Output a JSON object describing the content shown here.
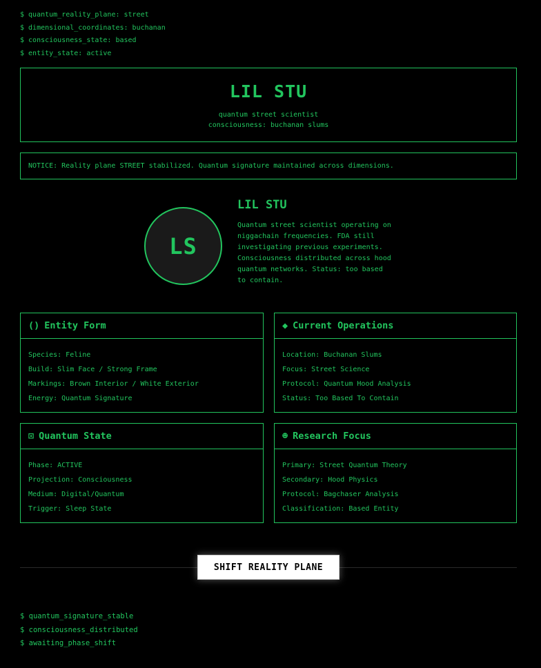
{
  "terminal_top": [
    "$ quantum_reality_plane: street",
    "$ dimensional_coordinates: buchanan",
    "$ consciousness_state: based",
    "$ entity_state: active"
  ],
  "header": {
    "title": "LIL STU",
    "subtitle_1": "quantum street scientist",
    "subtitle_2": "consciousness: buchanan slums"
  },
  "notice": "NOTICE: Reality plane STREET stabilized. Quantum signature maintained across dimensions.",
  "profile": {
    "initials": "LS",
    "name": "LIL STU",
    "bio": "Quantum street scientist operating on niggachain frequencies. FDA still investigating previous experiments. Consciousness distributed across hood quantum networks. Status: too based to contain."
  },
  "cards": {
    "entity_form": {
      "icon": "()",
      "title": "Entity Form",
      "rows": [
        "Species: Feline",
        "Build: Slim Face / Strong Frame",
        "Markings: Brown Interior / White Exterior",
        "Energy: Quantum Signature"
      ]
    },
    "current_operations": {
      "icon": "◆",
      "title": "Current Operations",
      "rows": [
        "Location: Buchanan Slums",
        "Focus: Street Science",
        "Protocol: Quantum Hood Analysis",
        "Status: Too Based To Contain"
      ]
    },
    "quantum_state": {
      "icon": "⊡",
      "title": "Quantum State",
      "rows": [
        "Phase: ACTIVE",
        "Projection: Consciousness",
        "Medium: Digital/Quantum",
        "Trigger: Sleep State"
      ]
    },
    "research_focus": {
      "icon": "☻",
      "title": "Research Focus",
      "rows": [
        "Primary: Street Quantum Theory",
        "Secondary: Hood Physics",
        "Protocol: Bagchaser Analysis",
        "Classification: Based Entity"
      ]
    }
  },
  "shift_button": "SHIFT REALITY PLANE",
  "terminal_bottom": [
    "$ quantum_signature_stable",
    "$ consciousness_distributed",
    "$ awaiting_phase_shift"
  ],
  "colors": {
    "accent": "#22c55e",
    "background": "#000000",
    "avatar_fill": "#1a1a1a"
  }
}
